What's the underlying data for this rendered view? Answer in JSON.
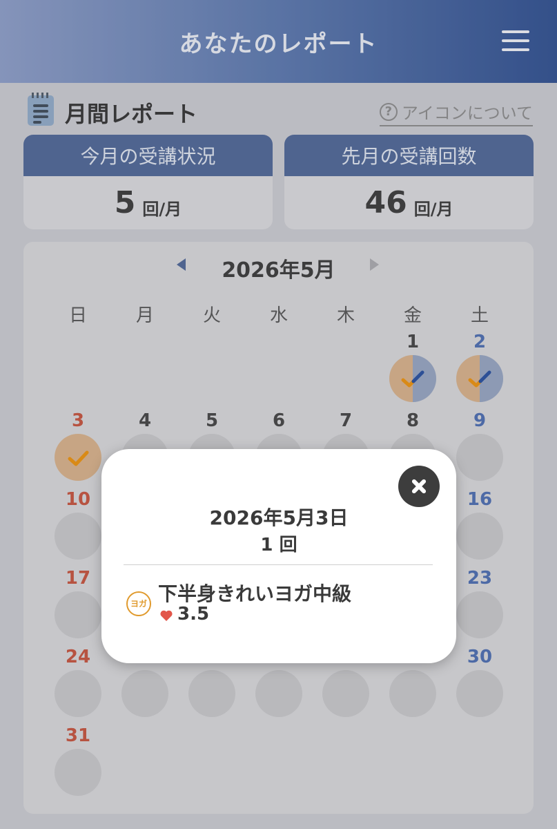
{
  "header": {
    "title": "あなたのレポート",
    "menu_icon": "hamburger-menu-icon"
  },
  "report": {
    "title": "月間レポート",
    "about_icons_link": "アイコンについて"
  },
  "stats": {
    "this_month": {
      "label": "今月の受講状況",
      "value": "5",
      "unit": "回/月"
    },
    "last_month": {
      "label": "先月の受講回数",
      "value": "46",
      "unit": "回/月"
    }
  },
  "calendar": {
    "month_label": "2026年5月",
    "weekdays": [
      "日",
      "月",
      "火",
      "水",
      "木",
      "金",
      "土"
    ],
    "days": [
      {
        "day": "1",
        "status": "attended-mixed"
      },
      {
        "day": "2",
        "status": "attended-mixed"
      },
      {
        "day": "3",
        "status": "attended"
      },
      {
        "day": "4"
      },
      {
        "day": "5"
      },
      {
        "day": "6"
      },
      {
        "day": "7"
      },
      {
        "day": "8"
      },
      {
        "day": "9"
      },
      {
        "day": "10"
      },
      {
        "day": "16"
      },
      {
        "day": "17"
      },
      {
        "day": "23"
      },
      {
        "day": "24"
      },
      {
        "day": "30"
      },
      {
        "day": "31"
      }
    ],
    "colors": {
      "sunday": "#c4533d",
      "saturday": "#4c6db0",
      "attended": "#d6b089",
      "attended_alt": "#94a3c0"
    }
  },
  "modal": {
    "date": "2026年5月3日",
    "count": "1 回",
    "lesson": {
      "badge": "ヨガ",
      "name": "下半身きれいヨガ中級",
      "rating": "3.5"
    }
  }
}
